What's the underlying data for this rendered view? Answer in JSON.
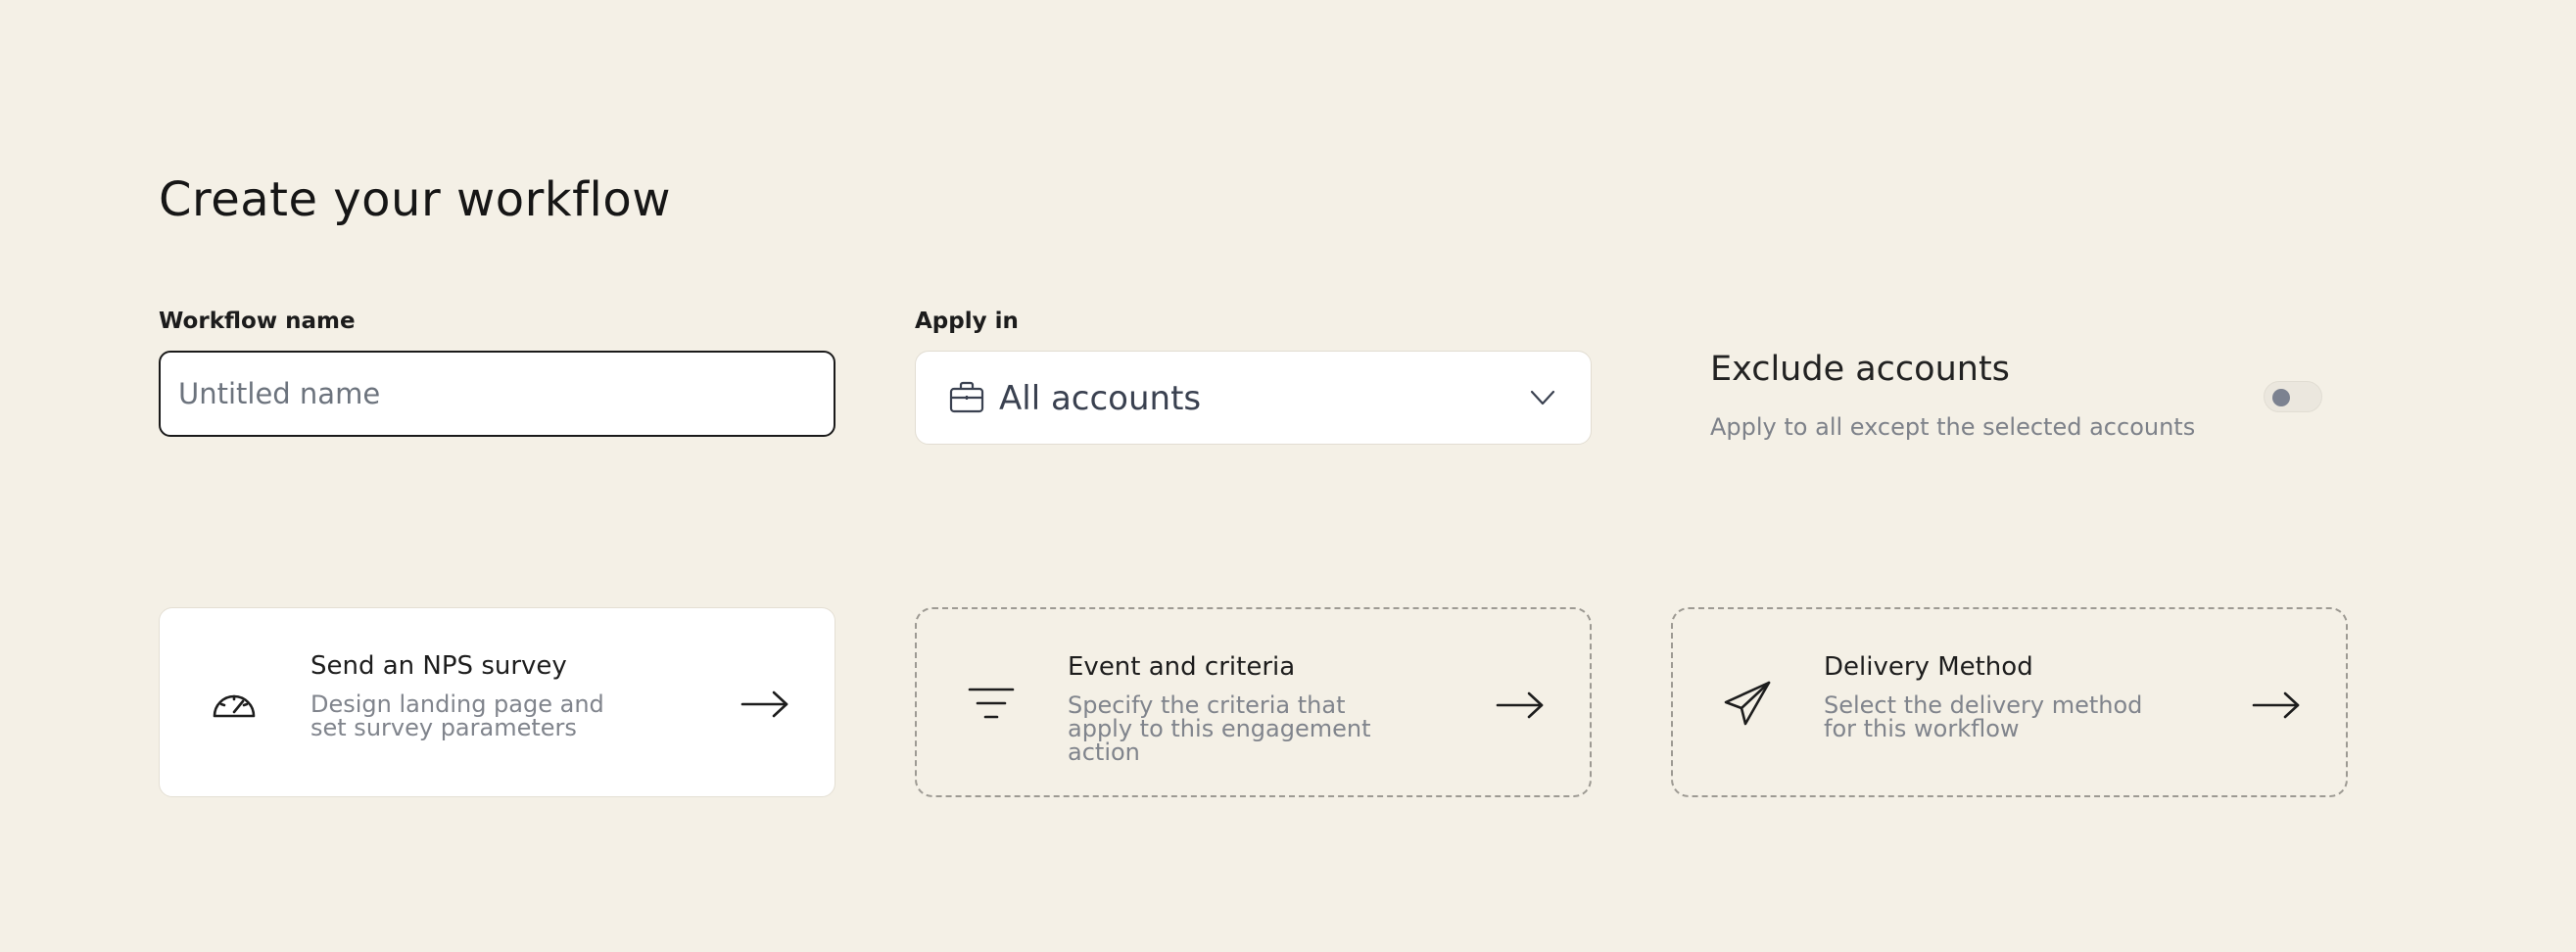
{
  "page": {
    "title": "Create your workflow"
  },
  "workflow_name": {
    "label": "Workflow name",
    "placeholder": "Untitled name",
    "value": ""
  },
  "apply_in": {
    "label": "Apply in",
    "selected": "All accounts",
    "icon": "briefcase-icon"
  },
  "exclude": {
    "title": "Exclude accounts",
    "subtitle": "Apply to all except the selected accounts",
    "enabled": false
  },
  "cards": [
    {
      "title": "Send an NPS survey",
      "description": "Design landing page and set survey parameters",
      "icon": "speedometer-icon",
      "style": "solid"
    },
    {
      "title": "Event and criteria",
      "description": "Specify the criteria that apply to this engagement action",
      "icon": "filter-icon",
      "style": "dashed"
    },
    {
      "title": "Delivery Method",
      "description": "Select the delivery method for this workflow",
      "icon": "paper-plane-icon",
      "style": "dashed"
    }
  ],
  "colors": {
    "background": "#f4f0e6",
    "text": "#1a1a1a",
    "muted": "#80848c",
    "card": "#ffffff"
  }
}
